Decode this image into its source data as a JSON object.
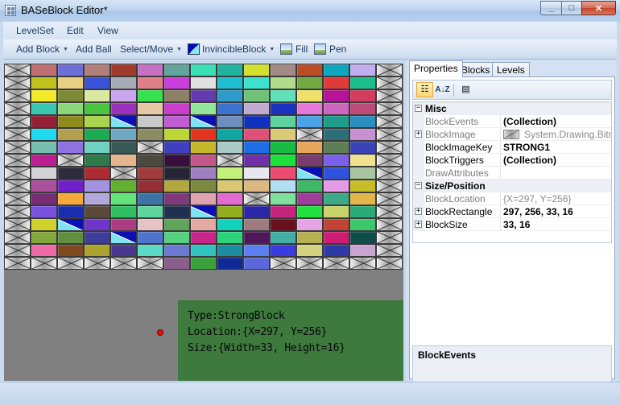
{
  "window": {
    "title": "BASeBlock Editor*"
  },
  "menubar": {
    "items": [
      "LevelSet",
      "Edit",
      "View"
    ]
  },
  "toolbar": {
    "add_block": "Add Block",
    "add_ball": "Add Ball",
    "select_move": "Select/Move",
    "invincible_block": "InvincibleBlock",
    "fill": "Fill",
    "pen": "Pen"
  },
  "canvas": {
    "background": "#808080",
    "info": {
      "type_line": "Type:StrongBlock",
      "location_line": "Location:{X=297, Y=256}",
      "size_line": "Size:{Width=33, Height=16}"
    },
    "grid": [
      [
        "D",
        "#c06f72",
        "#6e6ed8",
        "#b27f78",
        "#a03b2b",
        "#c66fc3",
        "#62a59e",
        "#37e1b3",
        "#20b49f",
        "#d4e02f",
        "#a48a85",
        "#bb4c24",
        "#0fa6c0",
        "#c1aef0",
        "D"
      ],
      [
        "D",
        "#c1c11c",
        "#e8d082",
        "#3a52d8",
        "#a8acb6",
        "#e07f8a",
        "#cd3edf",
        "#e1e0e0",
        "#1fbfd2",
        "#3ce3cc",
        "#b0dc8c",
        "#72aa41",
        "#e03a3a",
        "#1bbf8b",
        "D"
      ],
      [
        "D",
        "#f3ea28",
        "#7d8b36",
        "#d8e9a0",
        "#c9a6ef",
        "#37e04d",
        "#8d8065",
        "#643baf",
        "#2f9bcb",
        "#6ec379",
        "#60e0b6",
        "#eee06a",
        "#b71399",
        "#d43c5d",
        "D"
      ],
      [
        "D",
        "#3ac7b1",
        "#8bd77a",
        "#49c542",
        "#9d31bd",
        "#e7c7a4",
        "#ca3dcd",
        "#93e59b",
        "#3c72d0",
        "#bfaad0",
        "#1b31bf",
        "#e577d8",
        "#cc66bf",
        "#bf4a7a",
        "D"
      ],
      [
        "D",
        "#961f38",
        "#8e8b1c",
        "#a8d54d",
        "I",
        "#c9c9c9",
        "#c15cd2",
        "I",
        "#6e8fbe",
        "#0f31bd",
        "#5fd19f",
        "#4aa3e8",
        "#1e9e8a",
        "#2a8ec0",
        "D"
      ],
      [
        "D",
        "#1ddaf2",
        "#b3a04f",
        "#1caa53",
        "#6ea8c1",
        "#8b8c63",
        "#bcd636",
        "#e4341f",
        "#10a7a3",
        "#e04f7a",
        "#d9ca76",
        "D",
        "#2c6f79",
        "#c88fd2",
        "D"
      ],
      [
        "D",
        "#75c0b0",
        "#8e72e2",
        "#6fd2c0",
        "#3a5a57",
        "D",
        "#3e3fc1",
        "#c6b72a",
        "#a8c9c7",
        "#1d6ee3",
        "#16bc44",
        "#e6a65b",
        "#5e7f56",
        "#3b44b7",
        "D"
      ],
      [
        "D",
        "#bd1f93",
        "D",
        "#2f7a4a",
        "#e5b58d",
        "#4b4a3f",
        "#370e3c",
        "#c2578a",
        "D",
        "#6e2fa8",
        "#1fe03a",
        "#7a3c6e",
        "#7c5fea",
        "#f0e28f",
        "D"
      ],
      [
        "D",
        "#d2d1d8",
        "#2e2b3c",
        "#ad2a30",
        "D",
        "#a13c3d",
        "#252537",
        "#9f7fc2",
        "#c4f17a",
        "#e8e7ee",
        "#ec4c71",
        "I",
        "#2f52de",
        "#a8c4a0",
        "D"
      ],
      [
        "D",
        "#ad4f9c",
        "#7120c9",
        "#a292e2",
        "#62b02f",
        "#962f33",
        "#b3a73e",
        "#7c8a3e",
        "#d9c972",
        "#dbb87f",
        "#b2e0f2",
        "#3db864",
        "#e59ae7",
        "#c7bd27",
        "D"
      ],
      [
        "D",
        "#762b73",
        "#f6a83d",
        "#b2a8d9",
        "#63e47b",
        "#3e73a7",
        "#7f3a7b",
        "#e0a4b0",
        "#e46ad2",
        "D",
        "#7de09e",
        "#9f3d9b",
        "#3faa8a",
        "#e4b64a",
        "D"
      ],
      [
        "D",
        "#7b52e0",
        "#1b2cae",
        "#5a4838",
        "#2ec060",
        "#5fd59d",
        "#1f2f52",
        "I",
        "#92ae1d",
        "#2a27a6",
        "#c6247e",
        "#23e041",
        "#c8d46a",
        "#2aab76",
        "D"
      ],
      [
        "D",
        "#d1d12c",
        "I",
        "#6f35cb",
        "#ac3c84",
        "#e4c2c6",
        "#61a55c",
        "#e6a9a1",
        "#13d2ba",
        "#9d7b7f",
        "#6a0f1b",
        "#e5a5e5",
        "#c04434",
        "#3cc76c",
        "D"
      ],
      [
        "D",
        "#82a83c",
        "#5f8f3f",
        "#3c3e99",
        "I",
        "#4f74cd",
        "#55d281",
        "#c9258a",
        "#2cd37b",
        "#4f165a",
        "#43afa4",
        "#b6b04f",
        "#cf1c73",
        "#0f4d4b",
        "D"
      ],
      [
        "D",
        "#f06aa6",
        "#7f4a1f",
        "#aca32e",
        "#48378f",
        "#5ad9c5",
        "#6c7ad3",
        "#30c2bf",
        "#1a8ea0",
        "#5b7ef1",
        "#3a3cdf",
        "#d3d37f",
        "#2f3aa6",
        "#c8a4d2",
        "D"
      ],
      [
        "D",
        "D",
        "D",
        "D",
        "D",
        "D",
        "#8a5f8c",
        "#3aa03a",
        "#0d2a96",
        "#5b67da",
        "D",
        "D",
        "D",
        "D",
        "D"
      ]
    ]
  },
  "right_panel": {
    "tabs": [
      "Properties",
      "Blocks",
      "Levels"
    ],
    "property_grid": {
      "rows": [
        {
          "kind": "category",
          "name": "Misc",
          "expander": "−"
        },
        {
          "kind": "prop",
          "name": "BlockEvents",
          "value": "(Collection)",
          "name_style": "gray",
          "value_style": "bold"
        },
        {
          "kind": "prop",
          "name": "BlockImage",
          "value": "System.Drawing.Bitm",
          "name_style": "gray",
          "value_style": "gray",
          "expander": "+",
          "thumb": true
        },
        {
          "kind": "prop",
          "name": "BlockImageKey",
          "value": "STRONG1",
          "name_style": "normal",
          "value_style": "bold"
        },
        {
          "kind": "prop",
          "name": "BlockTriggers",
          "value": "(Collection)",
          "name_style": "normal",
          "value_style": "bold"
        },
        {
          "kind": "prop",
          "name": "DrawAttributes",
          "value": "",
          "name_style": "gray",
          "value_style": "gray"
        },
        {
          "kind": "category",
          "name": "Size/Position",
          "expander": "−"
        },
        {
          "kind": "prop",
          "name": "BlockLocation",
          "value": "{X=297, Y=256}",
          "name_style": "gray",
          "value_style": "gray"
        },
        {
          "kind": "prop",
          "name": "BlockRectangle",
          "value": "297, 256, 33, 16",
          "name_style": "normal",
          "value_style": "bold",
          "expander": "+"
        },
        {
          "kind": "prop",
          "name": "BlockSize",
          "value": "33, 16",
          "name_style": "normal",
          "value_style": "bold",
          "expander": "+"
        }
      ]
    },
    "description": {
      "title": "BlockEvents"
    }
  }
}
